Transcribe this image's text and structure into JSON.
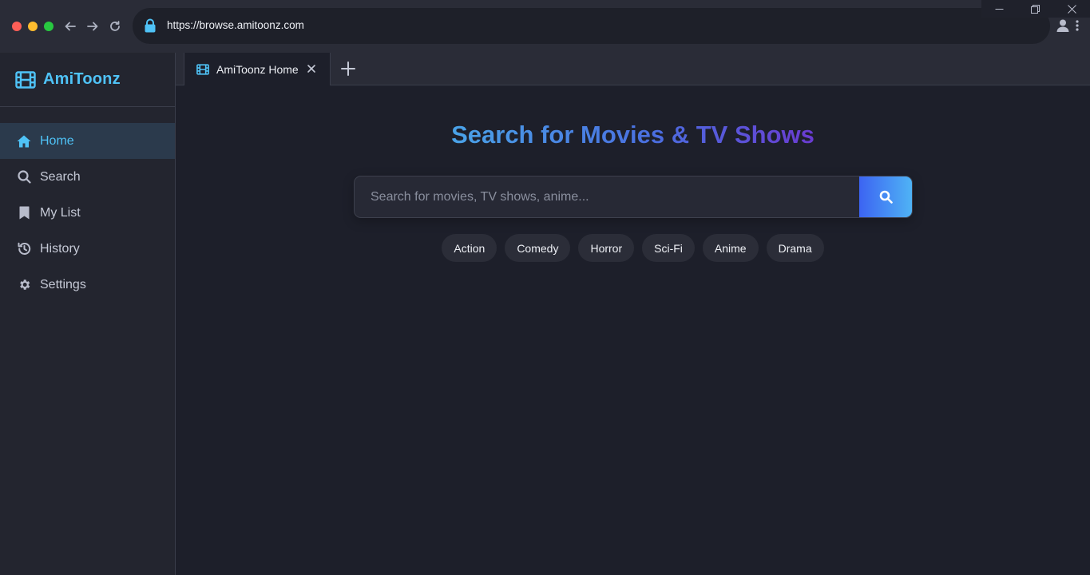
{
  "browser": {
    "url": "https://browse.amitoonz.com"
  },
  "sidebar": {
    "brand": "AmiToonz",
    "items": [
      {
        "label": "Home",
        "icon": "home-icon",
        "active": true
      },
      {
        "label": "Search",
        "icon": "search-icon",
        "active": false
      },
      {
        "label": "My List",
        "icon": "bookmark-icon",
        "active": false
      },
      {
        "label": "History",
        "icon": "history-icon",
        "active": false
      },
      {
        "label": "Settings",
        "icon": "gear-icon",
        "active": false
      }
    ]
  },
  "tabs": [
    {
      "title": "AmiToonz Home",
      "icon": "film-icon",
      "active": true
    }
  ],
  "main": {
    "headline": "Search for Movies & TV Shows",
    "search": {
      "placeholder": "Search for movies, TV shows, anime...",
      "value": ""
    },
    "genres": [
      "Action",
      "Comedy",
      "Horror",
      "Sci-Fi",
      "Anime",
      "Drama"
    ]
  },
  "colors": {
    "accent": "#4fc3f7",
    "background": "#1d1f2a",
    "sidebar": "#23252f",
    "active_item": "#2b3a4c"
  }
}
